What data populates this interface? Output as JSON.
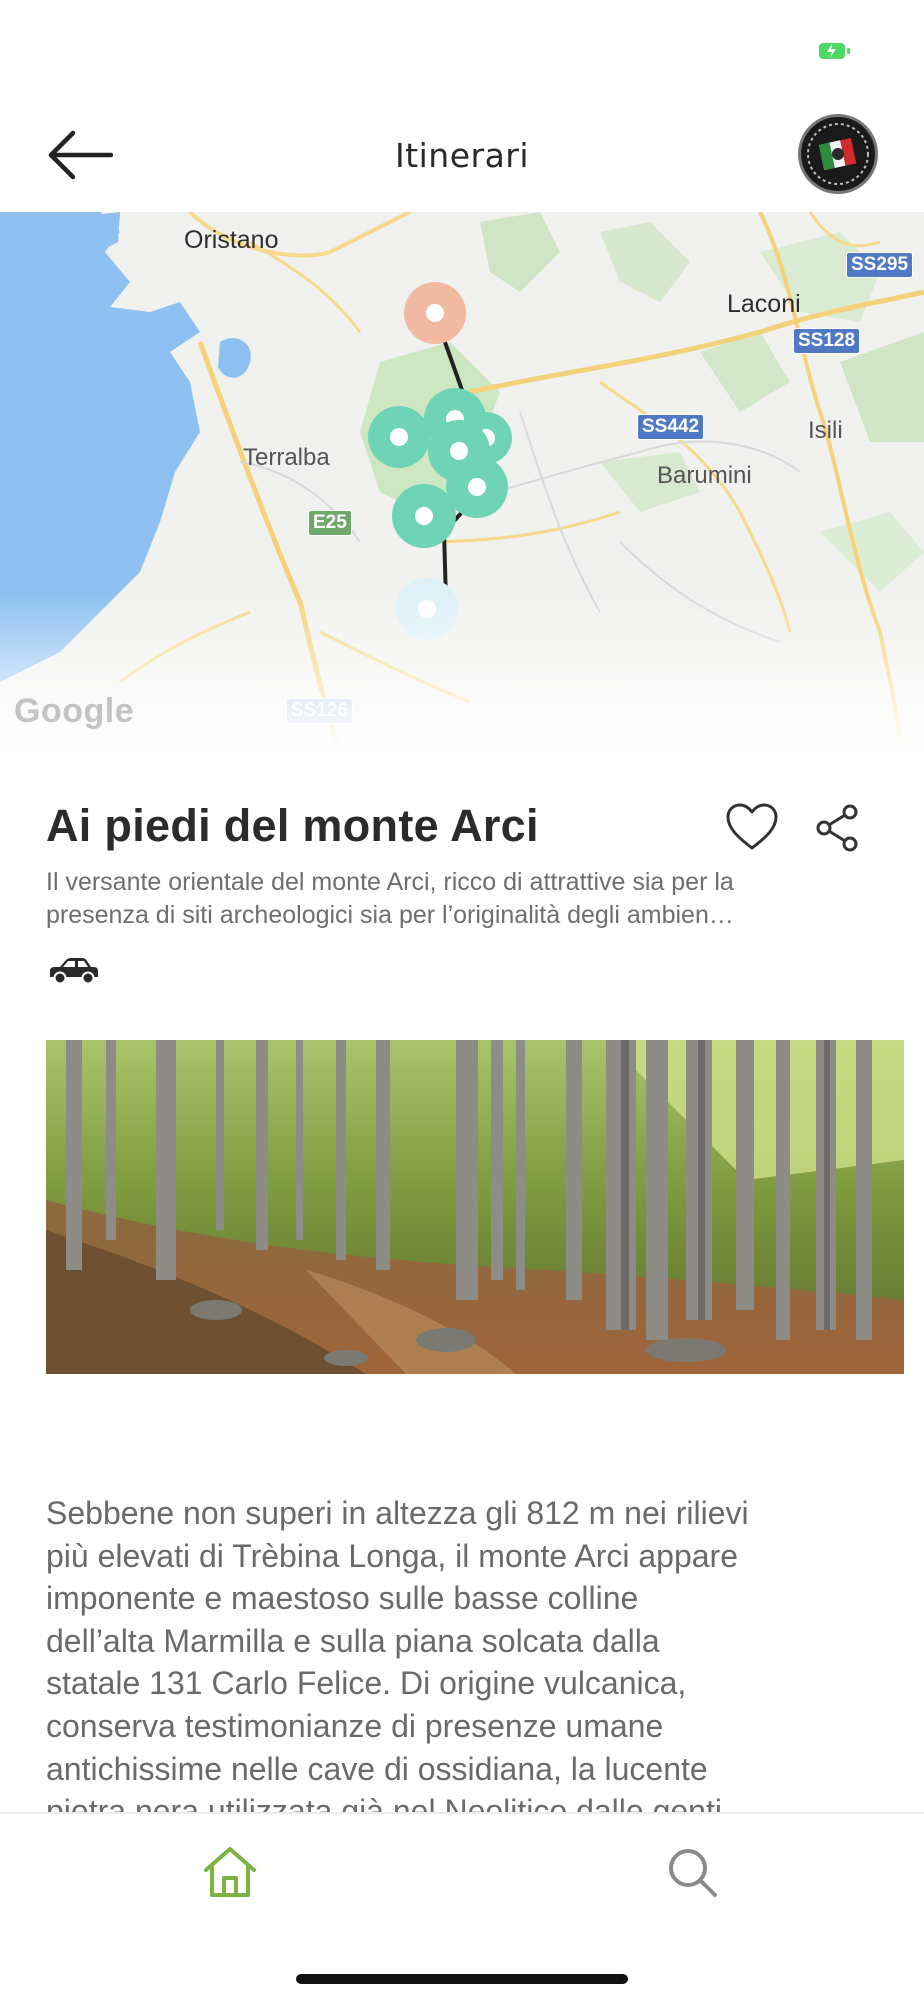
{
  "status_bar": {
    "battery_icon": "battery-charging-icon",
    "battery_color": "#4cd964"
  },
  "header": {
    "title": "Itinerari",
    "back_icon": "arrow-left-icon",
    "avatar_icon": "italian-flag-badge-icon"
  },
  "map": {
    "places": {
      "oristano": "Oristano",
      "laconi": "Laconi",
      "terralba": "Terralba",
      "isili": "Isili",
      "barumini": "Barumini"
    },
    "roads": {
      "ss295": "SS295",
      "ss128": "SS128",
      "ss442": "SS442",
      "e25": "E25",
      "ss126": "SS126"
    },
    "attribution": "Google",
    "marker_colors": {
      "start": "#f2b9a3",
      "stop": "#6fd4b5",
      "end": "#dff1f8",
      "route": "#222222"
    }
  },
  "itinerary": {
    "title": "Ai piedi del monte Arci",
    "summary_line1": "Il versante orientale del monte Arci, ricco di attrattive sia per la",
    "summary_line2": "presenza di siti archeologici sia per l’originalità degli ambien…",
    "transport_icon": "car-icon",
    "favorite_icon": "heart-outline-icon",
    "share_icon": "share-icon"
  },
  "description": {
    "line1": "Sebbene non superi in altezza gli 812 m nei rilievi",
    "line2": "più elevati di Trèbina Longa, il monte Arci appare",
    "line3": "imponente e maestoso sulle basse colline",
    "line4": "dell’alta Marmilla e sulla piana solcata dalla",
    "line5": "statale 131 Carlo Felice. Di origine vulcanica,",
    "line6": "conserva testimonianze di presenze umane",
    "line7": "antichissime nelle cave di ossidiana, la lucente",
    "line8": "pietra nera utilizzata già nel Neolitico dalle genti"
  },
  "bottom_nav": {
    "home_icon": "home-icon",
    "search_icon": "search-icon",
    "active_color": "#7cb342"
  }
}
